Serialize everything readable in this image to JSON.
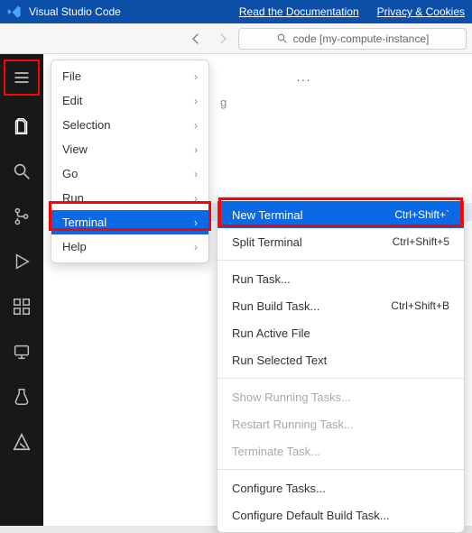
{
  "titlebar": {
    "app_name": "Visual Studio Code",
    "links": {
      "docs": "Read the Documentation",
      "privacy": "Privacy & Cookies"
    }
  },
  "search": {
    "text": "code [my-compute-instance]"
  },
  "overflow": "···",
  "stray_char": "g",
  "menu": {
    "items": [
      {
        "label": "File"
      },
      {
        "label": "Edit"
      },
      {
        "label": "Selection"
      },
      {
        "label": "View"
      },
      {
        "label": "Go"
      },
      {
        "label": "Run"
      },
      {
        "label": "Terminal",
        "selected": true
      },
      {
        "label": "Help"
      }
    ]
  },
  "submenu": {
    "groups": [
      [
        {
          "label": "New Terminal",
          "shortcut": "Ctrl+Shift+`",
          "selected": true
        },
        {
          "label": "Split Terminal",
          "shortcut": "Ctrl+Shift+5"
        }
      ],
      [
        {
          "label": "Run Task..."
        },
        {
          "label": "Run Build Task...",
          "shortcut": "Ctrl+Shift+B"
        },
        {
          "label": "Run Active File"
        },
        {
          "label": "Run Selected Text"
        }
      ],
      [
        {
          "label": "Show Running Tasks...",
          "disabled": true
        },
        {
          "label": "Restart Running Task...",
          "disabled": true
        },
        {
          "label": "Terminate Task...",
          "disabled": true
        }
      ],
      [
        {
          "label": "Configure Tasks..."
        },
        {
          "label": "Configure Default Build Task..."
        }
      ]
    ]
  },
  "colors": {
    "brand_blue": "#0b4fa9",
    "selection_blue": "#0a6ae6",
    "highlight_red": "#ff0000",
    "activity_bg": "#181818"
  }
}
